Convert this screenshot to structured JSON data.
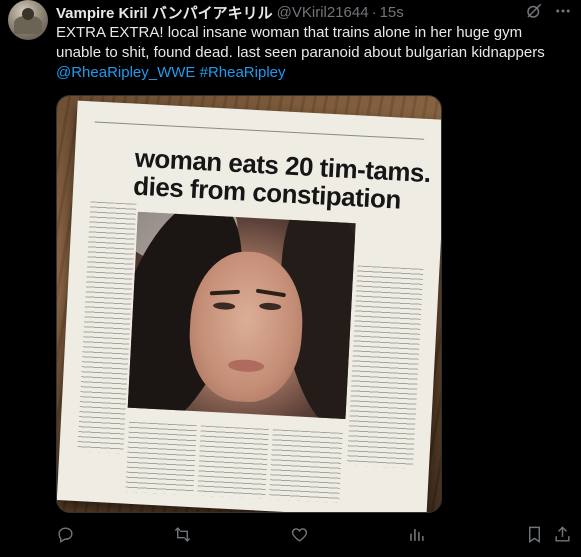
{
  "post": {
    "display_name": "Vampire Kiril バンパイアキリル",
    "handle": "@VKiril21644",
    "separator": "·",
    "time": "15s",
    "text_main": "EXTRA EXTRA! local insane woman that trains alone in her huge gym unable to shit, found dead. last seen paranoid about bulgarian kidnappers",
    "mentions": [
      "@RheaRipley_WWE",
      "#RheaRipley"
    ]
  },
  "media": {
    "headline": "woman eats 20 tim-tams. dies from constipation"
  },
  "icons": {
    "grok": "grok-icon",
    "more": "more-icon",
    "reply": "reply-icon",
    "retweet": "retweet-icon",
    "like": "heart-icon",
    "views": "views-icon",
    "bookmark": "bookmark-icon",
    "share": "share-icon"
  },
  "colors": {
    "background": "#000000",
    "text": "#e7e9ea",
    "muted": "#71767b",
    "link": "#1d9bf0"
  }
}
